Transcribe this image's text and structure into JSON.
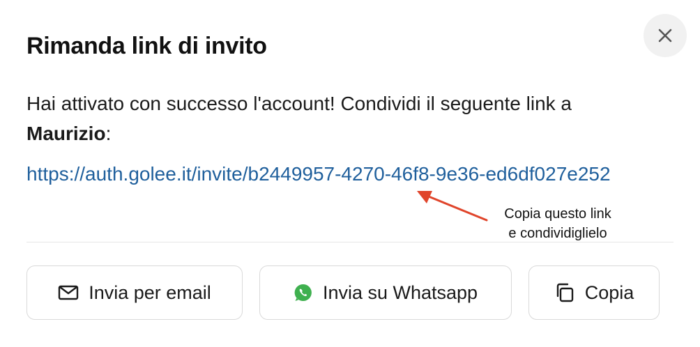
{
  "dialog": {
    "title": "Rimanda link di invito",
    "close_icon": "close-icon",
    "message_prefix": "Hai attivato con successo l'account! Condividi il seguente link a ",
    "recipient_name": "Maurizio",
    "message_suffix": ":",
    "invite_link": "https://auth.golee.it/invite/b2449957-4270-46f8-9e36-ed6df027e252",
    "annotation": {
      "line1": "Copia questo link",
      "line2": "e condividiglielo",
      "arrow_color": "#e0452b"
    },
    "buttons": {
      "email_label": "Invia per email",
      "email_icon": "mail-icon",
      "whatsapp_label": "Invia su Whatsapp",
      "whatsapp_icon": "whatsapp-icon",
      "copy_label": "Copia",
      "copy_icon": "copy-icon"
    }
  },
  "colors": {
    "link": "#1f5f9c",
    "whatsapp": "#3fb04f",
    "close_bg": "#f1f1f1"
  }
}
